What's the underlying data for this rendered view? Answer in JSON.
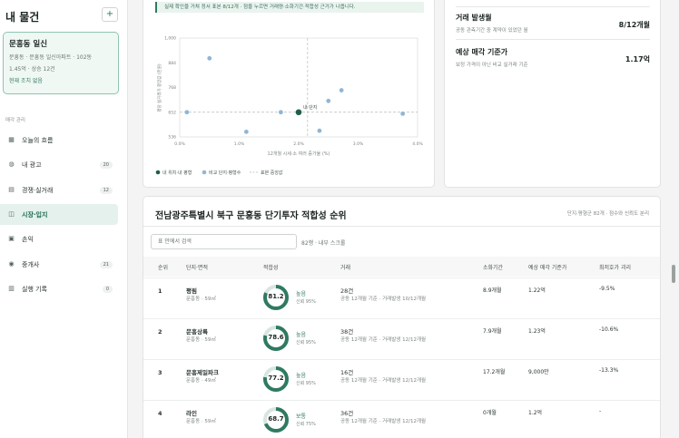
{
  "sidebar": {
    "title": "내 물건",
    "add_label": "+",
    "property": {
      "name": "문흥동 일신",
      "line1": "문흥동 · 문흥동 일신아파트 · 102동",
      "line2": "1.45억 · 상승 12건",
      "status": "현재 조치 없음"
    },
    "section_label": "매각 관리",
    "items": [
      {
        "label": "오늘의 흐름",
        "icon": "▦",
        "badge": ""
      },
      {
        "label": "내 광고",
        "icon": "◍",
        "badge": "20"
      },
      {
        "label": "경쟁·실거래",
        "icon": "▤",
        "badge": "12"
      },
      {
        "label": "시장·입지",
        "icon": "◫",
        "badge": ""
      },
      {
        "label": "손익",
        "icon": "▣",
        "badge": ""
      },
      {
        "label": "중개사",
        "icon": "◉",
        "badge": "21"
      },
      {
        "label": "실행 기록",
        "icon": "▥",
        "badge": "0"
      }
    ]
  },
  "chart": {
    "note": "실제 확인을 거쳐 정서 표본 8/12개 · 점을 누르면 거래량·소화기간·적합성 근거가 나옵니다.",
    "xlabel": "12개월 시세·소 여러 증가율 (%)",
    "ylabel": "평당 실거래가 중앙값 (만원)",
    "marker_label": "내 단지",
    "legend": [
      "내 위치·내 평형",
      "비교 단지·평형수",
      "표본 중앙값"
    ]
  },
  "chart_data": {
    "type": "scatter",
    "x_ticks": [
      "0.0%",
      "1.0%",
      "2.0%",
      "3.0%",
      "4.0%"
    ],
    "y_ticks": [
      "536",
      "652",
      "768",
      "884",
      "1,000"
    ],
    "xlim": [
      0,
      4
    ],
    "ylim": [
      536,
      1000
    ],
    "median": {
      "x": 2.15,
      "y": 652
    },
    "highlight": {
      "x": 2.0,
      "y": 652
    },
    "points": [
      {
        "x": 0.12,
        "y": 652
      },
      {
        "x": 0.5,
        "y": 905
      },
      {
        "x": 1.12,
        "y": 560
      },
      {
        "x": 1.7,
        "y": 652
      },
      {
        "x": 2.35,
        "y": 565
      },
      {
        "x": 2.5,
        "y": 705
      },
      {
        "x": 2.72,
        "y": 755
      },
      {
        "x": 3.75,
        "y": 645
      }
    ]
  },
  "summary": [
    {
      "label": "거래 발생월",
      "sub": "공동 관측기간 중 계약이 있었던 월",
      "value": "8/12개월"
    },
    {
      "label": "예상 매각 기준가",
      "sub": "보정 가격이 아닌 비교 실거래 기준",
      "value": "1.17억"
    }
  ],
  "ranking": {
    "title": "전남광주특별시 북구 문흥동 단기투자 적합성 순위",
    "meta": "단지·평형군 82개 · 점수와 신뢰도 분리",
    "search_placeholder": "표 안에서 검색",
    "search_count": "82행 · 내부 스크롤",
    "columns": [
      "순위",
      "단지·면적",
      "적합성",
      "거래",
      "소화기간",
      "예상 매각 기준가",
      "최저호가 괴리"
    ],
    "rows": [
      {
        "rank": "1",
        "name": "평림",
        "sub": "문흥동 · 59㎡",
        "score": "81.2",
        "score_pct": 0.812,
        "grade": "높음",
        "grade_sub": "신뢰 95%",
        "deal_main": "28건",
        "deal_sub": "공동 12개월 기준 · 거래발생 10/12개월",
        "period": "8.9개월",
        "price": "1.22억",
        "gap": "-9.5%"
      },
      {
        "rank": "2",
        "name": "문흥상록",
        "sub": "문흥동 · 59㎡",
        "score": "78.6",
        "score_pct": 0.786,
        "grade": "높음",
        "grade_sub": "신뢰 95%",
        "deal_main": "38건",
        "deal_sub": "공동 12개월 기준 · 거래발생 12/12개월",
        "period": "7.9개월",
        "price": "1.23억",
        "gap": "-10.6%"
      },
      {
        "rank": "3",
        "name": "문흥제일파크",
        "sub": "문흥동 · 49㎡",
        "score": "77.2",
        "score_pct": 0.772,
        "grade": "높음",
        "grade_sub": "신뢰 95%",
        "deal_main": "16건",
        "deal_sub": "공동 12개월 기준 · 거래발생 12/12개월",
        "period": "17.2개월",
        "price": "9,000만",
        "gap": "-13.3%"
      },
      {
        "rank": "4",
        "name": "라인",
        "sub": "문흥동 · 59㎡",
        "score": "68.7",
        "score_pct": 0.687,
        "grade": "보통",
        "grade_sub": "신뢰 75%",
        "deal_main": "36건",
        "deal_sub": "공동 12개월 기준 · 거래발생 12/12개월",
        "period": "0개월",
        "price": "1.2억",
        "gap": "-"
      }
    ]
  },
  "colors": {
    "accent": "#2f7a60",
    "highlight": "#1f5e4a",
    "point": "#8fb6d6",
    "ring_track": "#d8e6e0"
  }
}
